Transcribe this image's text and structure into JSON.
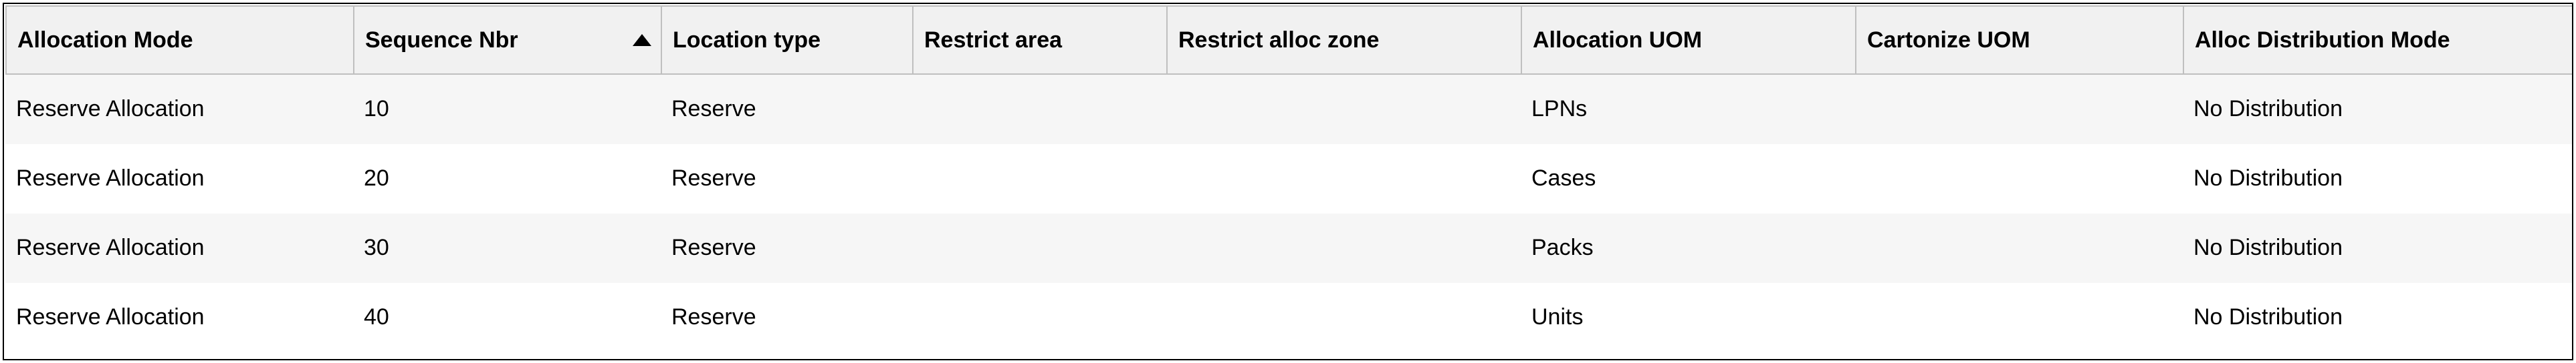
{
  "table": {
    "sort": {
      "column_index": 1,
      "direction": "asc"
    },
    "columns": [
      {
        "label": "Allocation Mode"
      },
      {
        "label": "Sequence Nbr"
      },
      {
        "label": "Location type"
      },
      {
        "label": "Restrict area"
      },
      {
        "label": "Restrict alloc zone"
      },
      {
        "label": "Allocation UOM"
      },
      {
        "label": "Cartonize UOM"
      },
      {
        "label": "Alloc Distribution Mode"
      }
    ],
    "rows": [
      {
        "allocation_mode": "Reserve Allocation",
        "sequence_nbr": "10",
        "location_type": "Reserve",
        "restrict_area": "",
        "restrict_alloc_zone": "",
        "allocation_uom": "LPNs",
        "cartonize_uom": "",
        "alloc_distribution_mode": "No Distribution"
      },
      {
        "allocation_mode": "Reserve Allocation",
        "sequence_nbr": "20",
        "location_type": "Reserve",
        "restrict_area": "",
        "restrict_alloc_zone": "",
        "allocation_uom": "Cases",
        "cartonize_uom": "",
        "alloc_distribution_mode": "No Distribution"
      },
      {
        "allocation_mode": "Reserve Allocation",
        "sequence_nbr": "30",
        "location_type": "Reserve",
        "restrict_area": "",
        "restrict_alloc_zone": "",
        "allocation_uom": "Packs",
        "cartonize_uom": "",
        "alloc_distribution_mode": "No Distribution"
      },
      {
        "allocation_mode": "Reserve Allocation",
        "sequence_nbr": "40",
        "location_type": "Reserve",
        "restrict_area": "",
        "restrict_alloc_zone": "",
        "allocation_uom": "Units",
        "cartonize_uom": "",
        "alloc_distribution_mode": "No Distribution"
      }
    ]
  }
}
